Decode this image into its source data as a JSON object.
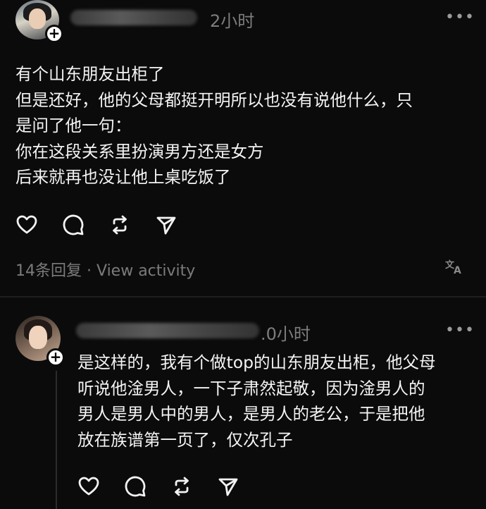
{
  "post1": {
    "time": "2小时",
    "more": "•••",
    "lines": [
      "有个山东朋友出柜了",
      "但是还好，他的父母都挺开明所以也没有说他什么，只",
      "是问了他一句：",
      "你在这段关系里扮演男方还是女方",
      "后来就再也没让他上桌吃饭了"
    ],
    "replies": "14条回复",
    "separator": "·",
    "view_activity": "View activity",
    "translate_icon": "translate-icon"
  },
  "post2": {
    "time": ".0小时",
    "more": "•••",
    "lines": [
      "是这样的，我有个做top的山东朋友出柜，他父母",
      "听说他淦男人，一下子肃然起敬，因为淦男人的",
      "男人是男人中的男人，是男人的老公，于是把他",
      "放在族谱第一页了，仅次孔子"
    ]
  },
  "icons": {
    "plus": "+",
    "like": "heart-icon",
    "comment": "comment-icon",
    "repost": "repost-icon",
    "share": "send-icon"
  },
  "colors": {
    "background": "#0b0b0b",
    "text": "#f4f4f4",
    "muted": "#7b7b7b"
  }
}
